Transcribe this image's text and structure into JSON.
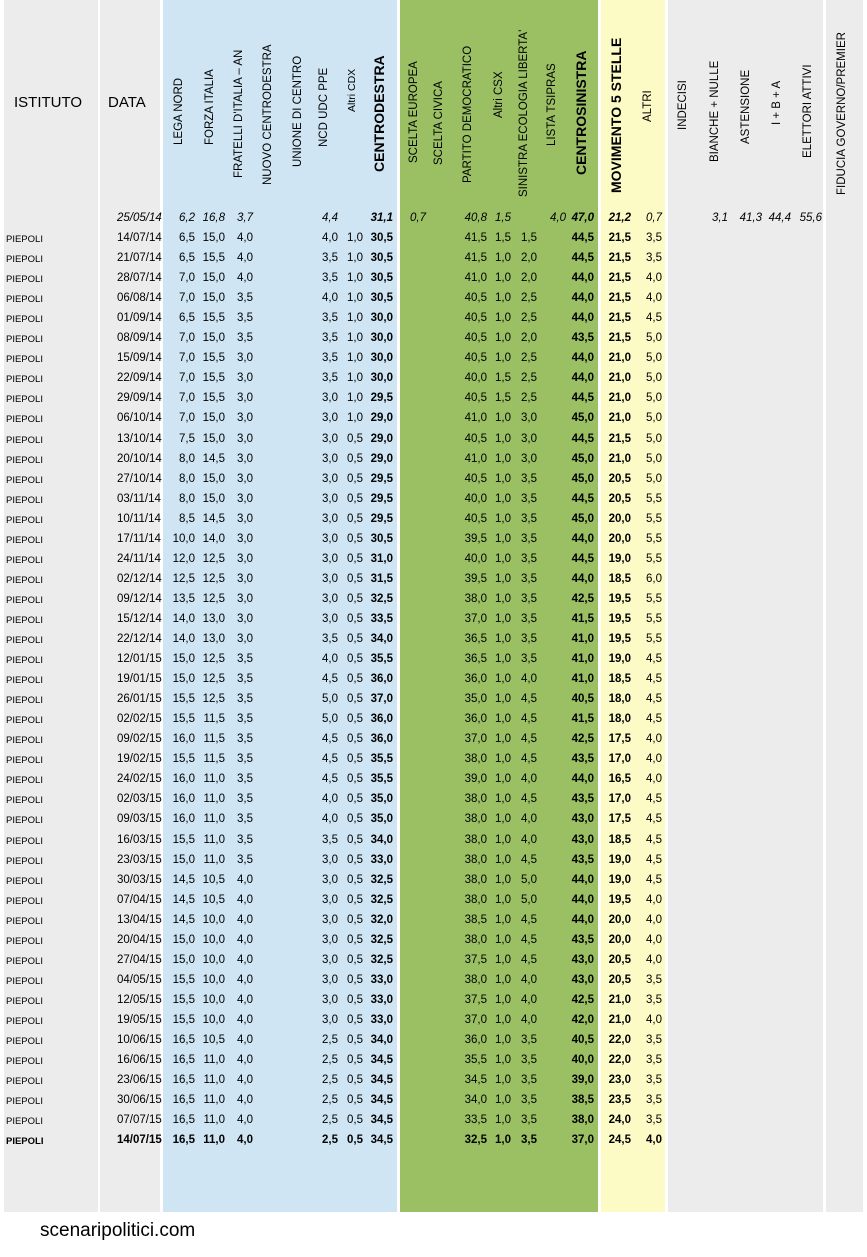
{
  "headers": {
    "istituto": "ISTITUTO",
    "data": "DATA",
    "columns": [
      "LEGA NORD",
      "FORZA ITALIA",
      "FRATELLI D'ITALIA – AN",
      "NUOVO CENTRODESTRA",
      "UNIONE DI CENTRO",
      "NCD UDC PPE",
      "Altri CDX",
      "CENTRODESTRA",
      "SCELTA EUROPEA",
      "SCELTA CIVICA",
      "PARTITO DEMOCRATICO",
      "Altri CSX",
      "SINISTRA ECOLOGIA LIBERTA'",
      "LISTA TSIPRAS",
      "CENTROSINISTRA",
      "MOVIMENTO 5 STELLE",
      "ALTRI",
      "INDECISI",
      "BIANCHE + NULLE",
      "ASTENSIONE",
      "I + B + A",
      "ELETTORI ATTIVI",
      "FIDUCIA GOVERNO/PREMIER"
    ]
  },
  "reference_row": {
    "data": "25/05/14",
    "lega": "6,2",
    "fi": "16,8",
    "fdi": "3,7",
    "ncdudc": "4,4",
    "cdx": "31,1",
    "se": "0,7",
    "pd": "40,8",
    "altricsx": "1,5",
    "tsipras": "4,0",
    "csx": "47,0",
    "m5s": "21,2",
    "altri": "0,7",
    "bianche": "3,1",
    "astensione": "41,3",
    "iba": "44,4",
    "elettori": "55,6"
  },
  "rows": [
    {
      "istituto": "PIEPOLI",
      "data": "14/07/14",
      "lega": "6,5",
      "fi": "15,0",
      "fdi": "4,0",
      "ncdudc": "4,0",
      "altricdx": "1,0",
      "cdx": "30,5",
      "pd": "41,5",
      "altricsx": "1,5",
      "sel": "1,5",
      "csx": "44,5",
      "m5s": "21,5",
      "altri": "3,5"
    },
    {
      "istituto": "PIEPOLI",
      "data": "21/07/14",
      "lega": "6,5",
      "fi": "15,5",
      "fdi": "4,0",
      "ncdudc": "3,5",
      "altricdx": "1,0",
      "cdx": "30,5",
      "pd": "41,5",
      "altricsx": "1,0",
      "sel": "2,0",
      "csx": "44,5",
      "m5s": "21,5",
      "altri": "3,5"
    },
    {
      "istituto": "PIEPOLI",
      "data": "28/07/14",
      "lega": "7,0",
      "fi": "15,0",
      "fdi": "4,0",
      "ncdudc": "3,5",
      "altricdx": "1,0",
      "cdx": "30,5",
      "pd": "41,0",
      "altricsx": "1,0",
      "sel": "2,0",
      "csx": "44,0",
      "m5s": "21,5",
      "altri": "4,0"
    },
    {
      "istituto": "PIEPOLI",
      "data": "06/08/14",
      "lega": "7,0",
      "fi": "15,0",
      "fdi": "3,5",
      "ncdudc": "4,0",
      "altricdx": "1,0",
      "cdx": "30,5",
      "pd": "40,5",
      "altricsx": "1,0",
      "sel": "2,5",
      "csx": "44,0",
      "m5s": "21,5",
      "altri": "4,0"
    },
    {
      "istituto": "PIEPOLI",
      "data": "01/09/14",
      "lega": "6,5",
      "fi": "15,5",
      "fdi": "3,5",
      "ncdudc": "3,5",
      "altricdx": "1,0",
      "cdx": "30,0",
      "pd": "40,5",
      "altricsx": "1,0",
      "sel": "2,5",
      "csx": "44,0",
      "m5s": "21,5",
      "altri": "4,5"
    },
    {
      "istituto": "PIEPOLI",
      "data": "08/09/14",
      "lega": "7,0",
      "fi": "15,0",
      "fdi": "3,5",
      "ncdudc": "3,5",
      "altricdx": "1,0",
      "cdx": "30,0",
      "pd": "40,5",
      "altricsx": "1,0",
      "sel": "2,0",
      "csx": "43,5",
      "m5s": "21,5",
      "altri": "5,0"
    },
    {
      "istituto": "PIEPOLI",
      "data": "15/09/14",
      "lega": "7,0",
      "fi": "15,5",
      "fdi": "3,0",
      "ncdudc": "3,5",
      "altricdx": "1,0",
      "cdx": "30,0",
      "pd": "40,5",
      "altricsx": "1,0",
      "sel": "2,5",
      "csx": "44,0",
      "m5s": "21,0",
      "altri": "5,0"
    },
    {
      "istituto": "PIEPOLI",
      "data": "22/09/14",
      "lega": "7,0",
      "fi": "15,5",
      "fdi": "3,0",
      "ncdudc": "3,5",
      "altricdx": "1,0",
      "cdx": "30,0",
      "pd": "40,0",
      "altricsx": "1,5",
      "sel": "2,5",
      "csx": "44,0",
      "m5s": "21,0",
      "altri": "5,0"
    },
    {
      "istituto": "PIEPOLI",
      "data": "29/09/14",
      "lega": "7,0",
      "fi": "15,5",
      "fdi": "3,0",
      "ncdudc": "3,0",
      "altricdx": "1,0",
      "cdx": "29,5",
      "pd": "40,5",
      "altricsx": "1,5",
      "sel": "2,5",
      "csx": "44,5",
      "m5s": "21,0",
      "altri": "5,0"
    },
    {
      "istituto": "PIEPOLI",
      "data": "06/10/14",
      "lega": "7,0",
      "fi": "15,0",
      "fdi": "3,0",
      "ncdudc": "3,0",
      "altricdx": "1,0",
      "cdx": "29,0",
      "pd": "41,0",
      "altricsx": "1,0",
      "sel": "3,0",
      "csx": "45,0",
      "m5s": "21,0",
      "altri": "5,0"
    },
    {
      "istituto": "PIEPOLI",
      "data": "13/10/14",
      "lega": "7,5",
      "fi": "15,0",
      "fdi": "3,0",
      "ncdudc": "3,0",
      "altricdx": "0,5",
      "cdx": "29,0",
      "pd": "40,5",
      "altricsx": "1,0",
      "sel": "3,0",
      "csx": "44,5",
      "m5s": "21,5",
      "altri": "5,0"
    },
    {
      "istituto": "PIEPOLI",
      "data": "20/10/14",
      "lega": "8,0",
      "fi": "14,5",
      "fdi": "3,0",
      "ncdudc": "3,0",
      "altricdx": "0,5",
      "cdx": "29,0",
      "pd": "41,0",
      "altricsx": "1,0",
      "sel": "3,0",
      "csx": "45,0",
      "m5s": "21,0",
      "altri": "5,0"
    },
    {
      "istituto": "PIEPOLI",
      "data": "27/10/14",
      "lega": "8,0",
      "fi": "15,0",
      "fdi": "3,0",
      "ncdudc": "3,0",
      "altricdx": "0,5",
      "cdx": "29,5",
      "pd": "40,5",
      "altricsx": "1,0",
      "sel": "3,5",
      "csx": "45,0",
      "m5s": "20,5",
      "altri": "5,0"
    },
    {
      "istituto": "PIEPOLI",
      "data": "03/11/14",
      "lega": "8,0",
      "fi": "15,0",
      "fdi": "3,0",
      "ncdudc": "3,0",
      "altricdx": "0,5",
      "cdx": "29,5",
      "pd": "40,0",
      "altricsx": "1,0",
      "sel": "3,5",
      "csx": "44,5",
      "m5s": "20,5",
      "altri": "5,5"
    },
    {
      "istituto": "PIEPOLI",
      "data": "10/11/14",
      "lega": "8,5",
      "fi": "14,5",
      "fdi": "3,0",
      "ncdudc": "3,0",
      "altricdx": "0,5",
      "cdx": "29,5",
      "pd": "40,5",
      "altricsx": "1,0",
      "sel": "3,5",
      "csx": "45,0",
      "m5s": "20,0",
      "altri": "5,5"
    },
    {
      "istituto": "PIEPOLI",
      "data": "17/11/14",
      "lega": "10,0",
      "fi": "14,0",
      "fdi": "3,0",
      "ncdudc": "3,0",
      "altricdx": "0,5",
      "cdx": "30,5",
      "pd": "39,5",
      "altricsx": "1,0",
      "sel": "3,5",
      "csx": "44,0",
      "m5s": "20,0",
      "altri": "5,5"
    },
    {
      "istituto": "PIEPOLI",
      "data": "24/11/14",
      "lega": "12,0",
      "fi": "12,5",
      "fdi": "3,0",
      "ncdudc": "3,0",
      "altricdx": "0,5",
      "cdx": "31,0",
      "pd": "40,0",
      "altricsx": "1,0",
      "sel": "3,5",
      "csx": "44,5",
      "m5s": "19,0",
      "altri": "5,5"
    },
    {
      "istituto": "PIEPOLI",
      "data": "02/12/14",
      "lega": "12,5",
      "fi": "12,5",
      "fdi": "3,0",
      "ncdudc": "3,0",
      "altricdx": "0,5",
      "cdx": "31,5",
      "pd": "39,5",
      "altricsx": "1,0",
      "sel": "3,5",
      "csx": "44,0",
      "m5s": "18,5",
      "altri": "6,0"
    },
    {
      "istituto": "PIEPOLI",
      "data": "09/12/14",
      "lega": "13,5",
      "fi": "12,5",
      "fdi": "3,0",
      "ncdudc": "3,0",
      "altricdx": "0,5",
      "cdx": "32,5",
      "pd": "38,0",
      "altricsx": "1,0",
      "sel": "3,5",
      "csx": "42,5",
      "m5s": "19,5",
      "altri": "5,5"
    },
    {
      "istituto": "PIEPOLI",
      "data": "15/12/14",
      "lega": "14,0",
      "fi": "13,0",
      "fdi": "3,0",
      "ncdudc": "3,0",
      "altricdx": "0,5",
      "cdx": "33,5",
      "pd": "37,0",
      "altricsx": "1,0",
      "sel": "3,5",
      "csx": "41,5",
      "m5s": "19,5",
      "altri": "5,5"
    },
    {
      "istituto": "PIEPOLI",
      "data": "22/12/14",
      "lega": "14,0",
      "fi": "13,0",
      "fdi": "3,0",
      "ncdudc": "3,5",
      "altricdx": "0,5",
      "cdx": "34,0",
      "pd": "36,5",
      "altricsx": "1,0",
      "sel": "3,5",
      "csx": "41,0",
      "m5s": "19,5",
      "altri": "5,5"
    },
    {
      "istituto": "PIEPOLI",
      "data": "12/01/15",
      "lega": "15,0",
      "fi": "12,5",
      "fdi": "3,5",
      "ncdudc": "4,0",
      "altricdx": "0,5",
      "cdx": "35,5",
      "pd": "36,5",
      "altricsx": "1,0",
      "sel": "3,5",
      "csx": "41,0",
      "m5s": "19,0",
      "altri": "4,5"
    },
    {
      "istituto": "PIEPOLI",
      "data": "19/01/15",
      "lega": "15,0",
      "fi": "12,5",
      "fdi": "3,5",
      "ncdudc": "4,5",
      "altricdx": "0,5",
      "cdx": "36,0",
      "pd": "36,0",
      "altricsx": "1,0",
      "sel": "4,0",
      "csx": "41,0",
      "m5s": "18,5",
      "altri": "4,5"
    },
    {
      "istituto": "PIEPOLI",
      "data": "26/01/15",
      "lega": "15,5",
      "fi": "12,5",
      "fdi": "3,5",
      "ncdudc": "5,0",
      "altricdx": "0,5",
      "cdx": "37,0",
      "pd": "35,0",
      "altricsx": "1,0",
      "sel": "4,5",
      "csx": "40,5",
      "m5s": "18,0",
      "altri": "4,5"
    },
    {
      "istituto": "PIEPOLI",
      "data": "02/02/15",
      "lega": "15,5",
      "fi": "11,5",
      "fdi": "3,5",
      "ncdudc": "5,0",
      "altricdx": "0,5",
      "cdx": "36,0",
      "pd": "36,0",
      "altricsx": "1,0",
      "sel": "4,5",
      "csx": "41,5",
      "m5s": "18,0",
      "altri": "4,5"
    },
    {
      "istituto": "PIEPOLI",
      "data": "09/02/15",
      "lega": "16,0",
      "fi": "11,5",
      "fdi": "3,5",
      "ncdudc": "4,5",
      "altricdx": "0,5",
      "cdx": "36,0",
      "pd": "37,0",
      "altricsx": "1,0",
      "sel": "4,5",
      "csx": "42,5",
      "m5s": "17,5",
      "altri": "4,0"
    },
    {
      "istituto": "PIEPOLI",
      "data": "19/02/15",
      "lega": "15,5",
      "fi": "11,5",
      "fdi": "3,5",
      "ncdudc": "4,5",
      "altricdx": "0,5",
      "cdx": "35,5",
      "pd": "38,0",
      "altricsx": "1,0",
      "sel": "4,5",
      "csx": "43,5",
      "m5s": "17,0",
      "altri": "4,0"
    },
    {
      "istituto": "PIEPOLI",
      "data": "24/02/15",
      "lega": "16,0",
      "fi": "11,0",
      "fdi": "3,5",
      "ncdudc": "4,5",
      "altricdx": "0,5",
      "cdx": "35,5",
      "pd": "39,0",
      "altricsx": "1,0",
      "sel": "4,0",
      "csx": "44,0",
      "m5s": "16,5",
      "altri": "4,0"
    },
    {
      "istituto": "PIEPOLI",
      "data": "02/03/15",
      "lega": "16,0",
      "fi": "11,0",
      "fdi": "3,5",
      "ncdudc": "4,0",
      "altricdx": "0,5",
      "cdx": "35,0",
      "pd": "38,0",
      "altricsx": "1,0",
      "sel": "4,5",
      "csx": "43,5",
      "m5s": "17,0",
      "altri": "4,5"
    },
    {
      "istituto": "PIEPOLI",
      "data": "09/03/15",
      "lega": "16,0",
      "fi": "11,0",
      "fdi": "3,5",
      "ncdudc": "4,0",
      "altricdx": "0,5",
      "cdx": "35,0",
      "pd": "38,0",
      "altricsx": "1,0",
      "sel": "4,0",
      "csx": "43,0",
      "m5s": "17,5",
      "altri": "4,5"
    },
    {
      "istituto": "PIEPOLI",
      "data": "16/03/15",
      "lega": "15,5",
      "fi": "11,0",
      "fdi": "3,5",
      "ncdudc": "3,5",
      "altricdx": "0,5",
      "cdx": "34,0",
      "pd": "38,0",
      "altricsx": "1,0",
      "sel": "4,0",
      "csx": "43,0",
      "m5s": "18,5",
      "altri": "4,5"
    },
    {
      "istituto": "PIEPOLI",
      "data": "23/03/15",
      "lega": "15,0",
      "fi": "11,0",
      "fdi": "3,5",
      "ncdudc": "3,0",
      "altricdx": "0,5",
      "cdx": "33,0",
      "pd": "38,0",
      "altricsx": "1,0",
      "sel": "4,5",
      "csx": "43,5",
      "m5s": "19,0",
      "altri": "4,5"
    },
    {
      "istituto": "PIEPOLI",
      "data": "30/03/15",
      "lega": "14,5",
      "fi": "10,5",
      "fdi": "4,0",
      "ncdudc": "3,0",
      "altricdx": "0,5",
      "cdx": "32,5",
      "pd": "38,0",
      "altricsx": "1,0",
      "sel": "5,0",
      "csx": "44,0",
      "m5s": "19,0",
      "altri": "4,5"
    },
    {
      "istituto": "PIEPOLI",
      "data": "07/04/15",
      "lega": "14,5",
      "fi": "10,5",
      "fdi": "4,0",
      "ncdudc": "3,0",
      "altricdx": "0,5",
      "cdx": "32,5",
      "pd": "38,0",
      "altricsx": "1,0",
      "sel": "5,0",
      "csx": "44,0",
      "m5s": "19,5",
      "altri": "4,0"
    },
    {
      "istituto": "PIEPOLI",
      "data": "13/04/15",
      "lega": "14,5",
      "fi": "10,0",
      "fdi": "4,0",
      "ncdudc": "3,0",
      "altricdx": "0,5",
      "cdx": "32,0",
      "pd": "38,5",
      "altricsx": "1,0",
      "sel": "4,5",
      "csx": "44,0",
      "m5s": "20,0",
      "altri": "4,0"
    },
    {
      "istituto": "PIEPOLI",
      "data": "20/04/15",
      "lega": "15,0",
      "fi": "10,0",
      "fdi": "4,0",
      "ncdudc": "3,0",
      "altricdx": "0,5",
      "cdx": "32,5",
      "pd": "38,0",
      "altricsx": "1,0",
      "sel": "4,5",
      "csx": "43,5",
      "m5s": "20,0",
      "altri": "4,0"
    },
    {
      "istituto": "PIEPOLI",
      "data": "27/04/15",
      "lega": "15,0",
      "fi": "10,0",
      "fdi": "4,0",
      "ncdudc": "3,0",
      "altricdx": "0,5",
      "cdx": "32,5",
      "pd": "37,5",
      "altricsx": "1,0",
      "sel": "4,5",
      "csx": "43,0",
      "m5s": "20,5",
      "altri": "4,0"
    },
    {
      "istituto": "PIEPOLI",
      "data": "04/05/15",
      "lega": "15,5",
      "fi": "10,0",
      "fdi": "4,0",
      "ncdudc": "3,0",
      "altricdx": "0,5",
      "cdx": "33,0",
      "pd": "38,0",
      "altricsx": "1,0",
      "sel": "4,0",
      "csx": "43,0",
      "m5s": "20,5",
      "altri": "3,5"
    },
    {
      "istituto": "PIEPOLI",
      "data": "12/05/15",
      "lega": "15,5",
      "fi": "10,0",
      "fdi": "4,0",
      "ncdudc": "3,0",
      "altricdx": "0,5",
      "cdx": "33,0",
      "pd": "37,5",
      "altricsx": "1,0",
      "sel": "4,0",
      "csx": "42,5",
      "m5s": "21,0",
      "altri": "3,5"
    },
    {
      "istituto": "PIEPOLI",
      "data": "19/05/15",
      "lega": "15,5",
      "fi": "10,0",
      "fdi": "4,0",
      "ncdudc": "3,0",
      "altricdx": "0,5",
      "cdx": "33,0",
      "pd": "37,0",
      "altricsx": "1,0",
      "sel": "4,0",
      "csx": "42,0",
      "m5s": "21,0",
      "altri": "4,0"
    },
    {
      "istituto": "PIEPOLI",
      "data": "10/06/15",
      "lega": "16,5",
      "fi": "10,5",
      "fdi": "4,0",
      "ncdudc": "2,5",
      "altricdx": "0,5",
      "cdx": "34,0",
      "pd": "36,0",
      "altricsx": "1,0",
      "sel": "3,5",
      "csx": "40,5",
      "m5s": "22,0",
      "altri": "3,5"
    },
    {
      "istituto": "PIEPOLI",
      "data": "16/06/15",
      "lega": "16,5",
      "fi": "11,0",
      "fdi": "4,0",
      "ncdudc": "2,5",
      "altricdx": "0,5",
      "cdx": "34,5",
      "pd": "35,5",
      "altricsx": "1,0",
      "sel": "3,5",
      "csx": "40,0",
      "m5s": "22,0",
      "altri": "3,5"
    },
    {
      "istituto": "PIEPOLI",
      "data": "23/06/15",
      "lega": "16,5",
      "fi": "11,0",
      "fdi": "4,0",
      "ncdudc": "2,5",
      "altricdx": "0,5",
      "cdx": "34,5",
      "pd": "34,5",
      "altricsx": "1,0",
      "sel": "3,5",
      "csx": "39,0",
      "m5s": "23,0",
      "altri": "3,5"
    },
    {
      "istituto": "PIEPOLI",
      "data": "30/06/15",
      "lega": "16,5",
      "fi": "11,0",
      "fdi": "4,0",
      "ncdudc": "2,5",
      "altricdx": "0,5",
      "cdx": "34,5",
      "pd": "34,0",
      "altricsx": "1,0",
      "sel": "3,5",
      "csx": "38,5",
      "m5s": "23,5",
      "altri": "3,5"
    },
    {
      "istituto": "PIEPOLI",
      "data": "07/07/15",
      "lega": "16,5",
      "fi": "11,0",
      "fdi": "4,0",
      "ncdudc": "2,5",
      "altricdx": "0,5",
      "cdx": "34,5",
      "pd": "33,5",
      "altricsx": "1,0",
      "sel": "3,5",
      "csx": "38,0",
      "m5s": "24,0",
      "altri": "3,5"
    },
    {
      "istituto": "PIEPOLI",
      "data": "14/07/15",
      "lega": "16,5",
      "fi": "11,0",
      "fdi": "4,0",
      "ncdudc": "2,5",
      "altricdx": "0,5",
      "cdx": "34,5",
      "pd": "32,5",
      "altricsx": "1,0",
      "sel": "3,5",
      "csx": "37,0",
      "m5s": "24,5",
      "altri": "4,0",
      "bold": true
    }
  ],
  "footer": "scenaripolitici.com"
}
